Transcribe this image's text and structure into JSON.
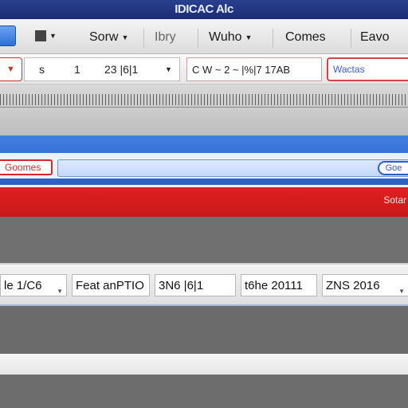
{
  "window": {
    "title": "IDICAC Alc"
  },
  "menubar": {
    "items": [
      {
        "label": "Sorw"
      },
      {
        "label": "Ibry"
      },
      {
        "label": "Wuho"
      },
      {
        "label": "Comes"
      },
      {
        "label": "Eavo"
      }
    ]
  },
  "toolbar": {
    "field1_a": "s",
    "field1_b": "1",
    "field1_c": "23 |6|1",
    "field2": "C W ~ 2 ~ |%|7 17AB",
    "search_value": "Wactas"
  },
  "addressbar": {
    "tab_label": "Goomes",
    "go_label": "Goe"
  },
  "redbar": {
    "label": "Sotar"
  },
  "datarow": {
    "cells": [
      {
        "value": "le 1/C6"
      },
      {
        "value": "Feat anPTIO"
      },
      {
        "value": "3N6 |6|1"
      },
      {
        "value": "t6he 20111"
      },
      {
        "value": "ZNS 2016"
      }
    ]
  },
  "colors": {
    "titlebar": "#1a2c74",
    "accent_blue": "#2c5fc4",
    "accent_red": "#d62828"
  }
}
